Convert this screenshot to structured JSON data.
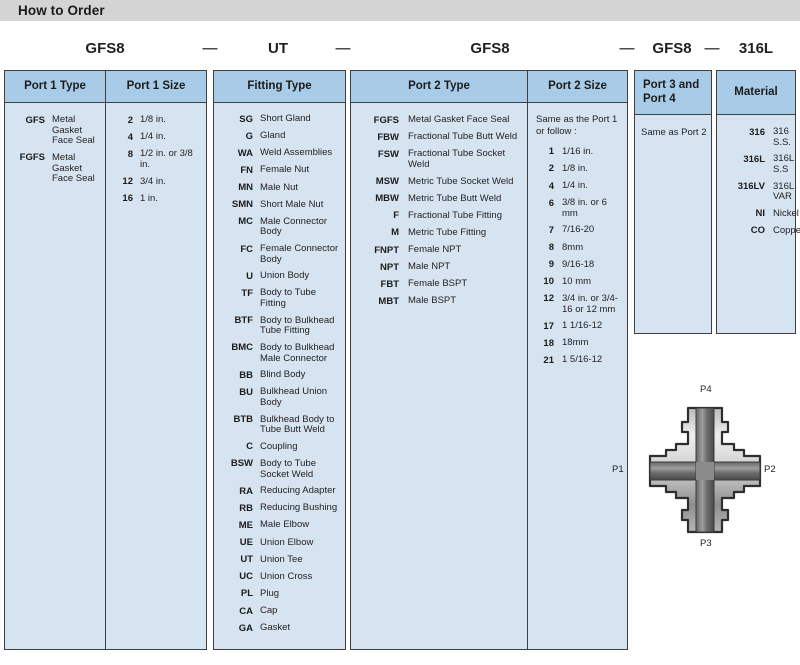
{
  "title": "How to Order",
  "order_code": {
    "segments": [
      "GFS8",
      "UT",
      "GFS8",
      "GFS8",
      "316L"
    ],
    "dash": "—"
  },
  "headers": {
    "port1_type": "Port 1 Type",
    "port1_size": "Port 1 Size",
    "fitting_type": "Fitting Type",
    "port2_type": "Port 2 Type",
    "port2_size": "Port 2 Size",
    "port3_and_4": "Port 3 and Port 4",
    "material": "Material"
  },
  "port1_type": [
    {
      "code": "GFS",
      "desc": "Metal Gasket Face Seal"
    },
    {
      "code": "FGFS",
      "desc": "Metal Gasket Face Seal"
    }
  ],
  "port1_size": [
    {
      "code": "2",
      "desc": "1/8 in."
    },
    {
      "code": "4",
      "desc": "1/4 in."
    },
    {
      "code": "8",
      "desc": "1/2 in. or 3/8 in."
    },
    {
      "code": "12",
      "desc": "3/4 in."
    },
    {
      "code": "16",
      "desc": "1 in."
    }
  ],
  "fitting_type": [
    {
      "code": "SG",
      "desc": "Short Gland"
    },
    {
      "code": "G",
      "desc": "Gland"
    },
    {
      "code": "WA",
      "desc": "Weld Assemblies"
    },
    {
      "code": "FN",
      "desc": "Female Nut"
    },
    {
      "code": "MN",
      "desc": "Male Nut"
    },
    {
      "code": "SMN",
      "desc": "Short Male Nut"
    },
    {
      "code": "MC",
      "desc": "Male Connector Body"
    },
    {
      "code": "FC",
      "desc": "Female Connector Body"
    },
    {
      "code": "U",
      "desc": "Union Body"
    },
    {
      "code": "TF",
      "desc": "Body to Tube Fitting"
    },
    {
      "code": "BTF",
      "desc": "Body to Bulkhead Tube Fitting"
    },
    {
      "code": "BMC",
      "desc": "Body to Bulkhead Male Connector"
    },
    {
      "code": "BB",
      "desc": "Blind Body"
    },
    {
      "code": "BU",
      "desc": "Bulkhead Union Body"
    },
    {
      "code": "BTB",
      "desc": "Bulkhead Body to Tube Butt Weld"
    },
    {
      "code": "C",
      "desc": "Coupling"
    },
    {
      "code": "BSW",
      "desc": "Body to Tube Socket Weld"
    },
    {
      "code": "RA",
      "desc": "Reducing Adapter"
    },
    {
      "code": "RB",
      "desc": "Reducing Bushing"
    },
    {
      "code": "ME",
      "desc": "Male Elbow"
    },
    {
      "code": "UE",
      "desc": "Union Elbow"
    },
    {
      "code": "UT",
      "desc": "Union Tee"
    },
    {
      "code": "UC",
      "desc": "Union Cross"
    },
    {
      "code": "PL",
      "desc": "Plug"
    },
    {
      "code": "CA",
      "desc": "Cap"
    },
    {
      "code": "GA",
      "desc": "Gasket"
    }
  ],
  "port2_type": [
    {
      "code": "FGFS",
      "desc": "Metal Gasket Face Seal"
    },
    {
      "code": "FBW",
      "desc": "Fractional Tube Butt Weld"
    },
    {
      "code": "FSW",
      "desc": "Fractional Tube Socket Weld"
    },
    {
      "code": "MSW",
      "desc": "Metric Tube Socket Weld"
    },
    {
      "code": "MBW",
      "desc": "Metric Tube Butt Weld"
    },
    {
      "code": "F",
      "desc": "Fractional Tube Fitting"
    },
    {
      "code": "M",
      "desc": "Metric Tube Fitting"
    },
    {
      "code": "FNPT",
      "desc": "Female NPT"
    },
    {
      "code": "NPT",
      "desc": "Male NPT"
    },
    {
      "code": "FBT",
      "desc": "Female BSPT"
    },
    {
      "code": "MBT",
      "desc": "Male BSPT"
    }
  ],
  "port2_size": {
    "note": "Same as the Port 1 or  follow :",
    "items": [
      {
        "code": "1",
        "desc": "1/16 in."
      },
      {
        "code": "2",
        "desc": "1/8 in."
      },
      {
        "code": "4",
        "desc": "1/4 in."
      },
      {
        "code": "6",
        "desc": "3/8 in. or 6 mm"
      },
      {
        "code": "7",
        "desc": "7/16-20"
      },
      {
        "code": "8",
        "desc": "8mm"
      },
      {
        "code": "9",
        "desc": "9/16-18"
      },
      {
        "code": "10",
        "desc": "10 mm"
      },
      {
        "code": "12",
        "desc": "3/4 in. or 3/4-16 or 12 mm"
      },
      {
        "code": "17",
        "desc": "1 1/16-12"
      },
      {
        "code": "18",
        "desc": "18mm"
      },
      {
        "code": "21",
        "desc": "1 5/16-12"
      }
    ]
  },
  "port3_and_4": {
    "note": "Same as  Port 2"
  },
  "material": [
    {
      "code": "316",
      "desc": "316 S.S."
    },
    {
      "code": "316L",
      "desc": "316L S.S"
    },
    {
      "code": "316LV",
      "desc": "316L VAR"
    },
    {
      "code": "NI",
      "desc": "Nickel"
    },
    {
      "code": "CO",
      "desc": "Copper"
    }
  ],
  "diagram": {
    "name": "union-cross-fitting",
    "labels": {
      "p1": "P1",
      "p2": "P2",
      "p3": "P3",
      "p4": "P4"
    }
  },
  "colors": {
    "header_blue": "#a8cbe8",
    "body_blue": "#d6e3f0",
    "border": "#3f3f3f",
    "titlebar_gray": "#d4d4d4"
  }
}
